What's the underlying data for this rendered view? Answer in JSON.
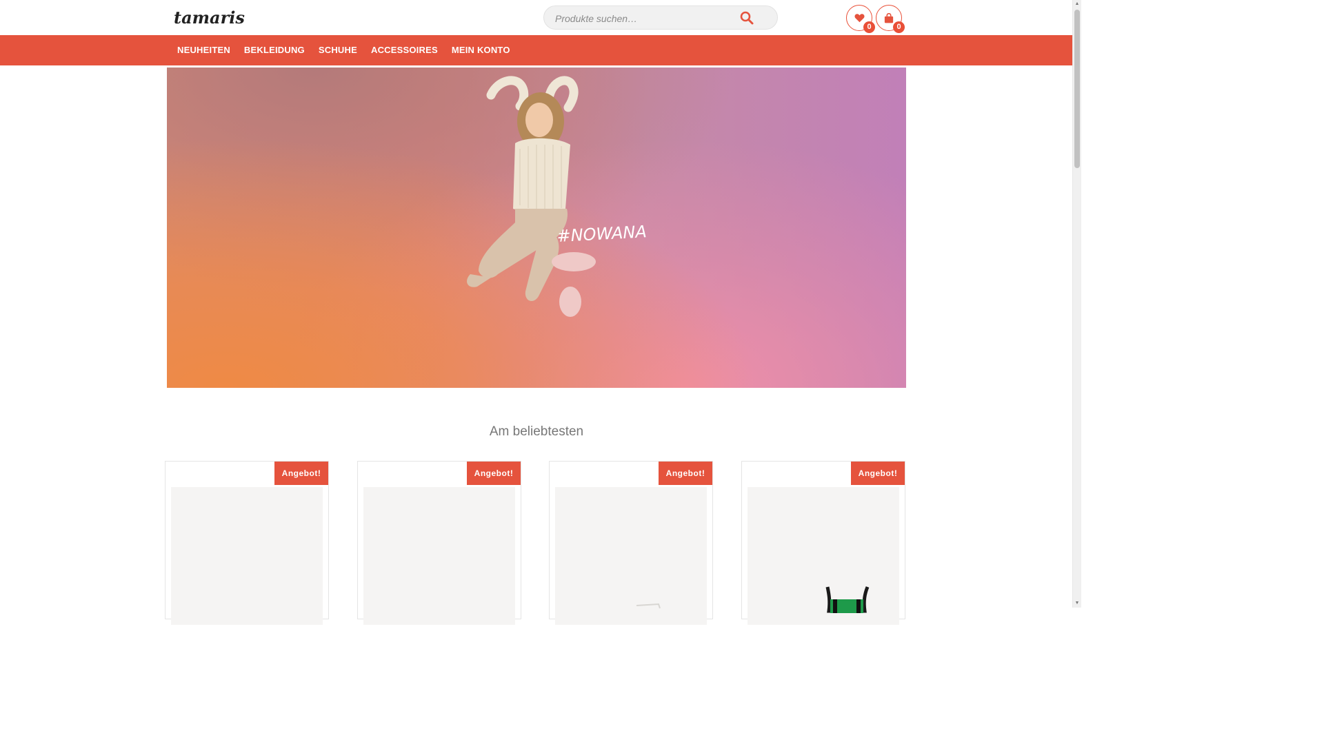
{
  "header": {
    "logo_text": "tamaris",
    "search": {
      "placeholder": "Produkte suchen…"
    },
    "wishlist_count": "0",
    "cart_count": "0"
  },
  "nav": {
    "items": [
      "NEUHEITEN",
      "BEKLEIDUNG",
      "SCHUHE",
      "ACCESSOIRES",
      "MEIN KONTO"
    ]
  },
  "hero": {
    "hashtag": "#NOWANA"
  },
  "bestsellers": {
    "title": "Am beliebtesten",
    "products": [
      {
        "badge": "Angebot!"
      },
      {
        "badge": "Angebot!"
      },
      {
        "badge": "Angebot!"
      },
      {
        "badge": "Angebot!"
      }
    ]
  },
  "colors": {
    "accent": "#e5533d",
    "nav_background": "#e5533d",
    "text_muted": "#777777"
  },
  "icons": [
    "search-icon",
    "heart-icon",
    "shopping-bag-icon"
  ]
}
